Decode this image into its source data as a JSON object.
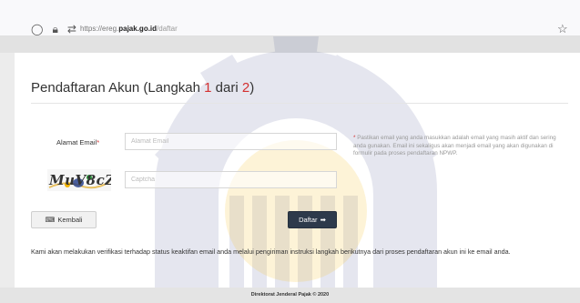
{
  "browser": {
    "url_prefix": "https://ereg.",
    "url_host": "pajak.go.id",
    "url_path": "/daftar"
  },
  "page": {
    "title_prefix": "Pendaftaran Akun  (Langkah ",
    "step_current": "1",
    "title_middle": " dari ",
    "step_total": "2",
    "title_suffix": ")"
  },
  "form": {
    "email_label": "Alamat Email",
    "required_mark": "*",
    "email_placeholder": "Alamat Email",
    "captcha_text": "MuV8cZ",
    "captcha_placeholder": "Captcha",
    "hint_mark": "*",
    "hint_text": " Pastikan email yang anda masukkan adalah email yang masih aktif dan sering anda gunakan. Email ini sekaligus akan menjadi email yang akan digunakan di formulir pada proses pendaftaran NPWP."
  },
  "buttons": {
    "back_label": "Kembali",
    "submit_label": "Daftar"
  },
  "info_text": "Kami akan melakukan verifikasi terhadap status keaktifan email anda melalui pengiriman instruksi langkah berikutnya dari proses pendaftaran akun ini ke email anda.",
  "footer_text": "Direktorat Jenderal Pajak © 2020",
  "colors": {
    "required": "#d32f2f",
    "submit_bg": "#2d3a4b",
    "watermark_gear": "#1f2b73",
    "watermark_sun": "#f7c948"
  },
  "icons": [
    "shield-icon",
    "lock-icon",
    "tracker-icon",
    "star-icon",
    "arrow-left-circle-icon",
    "arrow-right-circle-icon"
  ]
}
